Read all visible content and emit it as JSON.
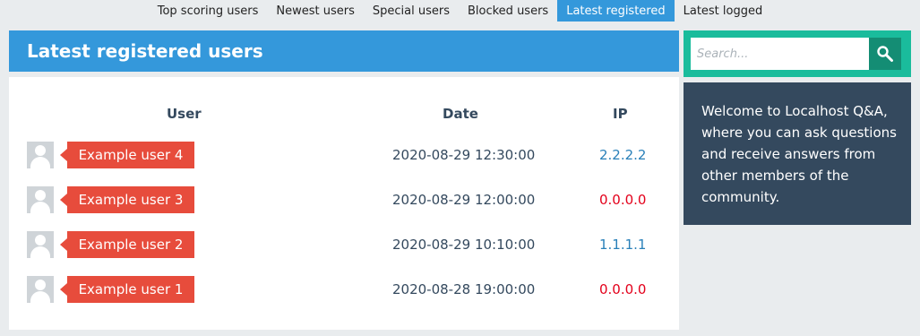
{
  "subnav": {
    "items": [
      {
        "label": "Top scoring users"
      },
      {
        "label": "Newest users"
      },
      {
        "label": "Special users"
      },
      {
        "label": "Blocked users"
      },
      {
        "label": "Latest registered"
      },
      {
        "label": "Latest logged"
      }
    ],
    "active_index": 4
  },
  "main": {
    "title": "Latest registered users",
    "columns": {
      "user": "User",
      "date": "Date",
      "ip": "IP"
    },
    "rows": [
      {
        "user": "Example user 4",
        "date": "2020-08-29 12:30:00",
        "ip": "2.2.2.2",
        "ip_color": "#2980b9"
      },
      {
        "user": "Example user 3",
        "date": "2020-08-29 12:00:00",
        "ip": "0.0.0.0",
        "ip_color": "#e3001b"
      },
      {
        "user": "Example user 2",
        "date": "2020-08-29 10:10:00",
        "ip": "1.1.1.1",
        "ip_color": "#2980b9"
      },
      {
        "user": "Example user 1",
        "date": "2020-08-28 19:00:00",
        "ip": "0.0.0.0",
        "ip_color": "#e3001b"
      }
    ]
  },
  "sidebar": {
    "search": {
      "placeholder": "Search...",
      "icon": "search-icon"
    },
    "welcome": "Welcome to Localhost Q&A, where you can ask questions and receive answers from other members of the community."
  },
  "colors": {
    "primary": "#3498db",
    "user_tag": "#e74c3c",
    "search_bg": "#1abc9c",
    "welcome_bg": "#34495e"
  }
}
